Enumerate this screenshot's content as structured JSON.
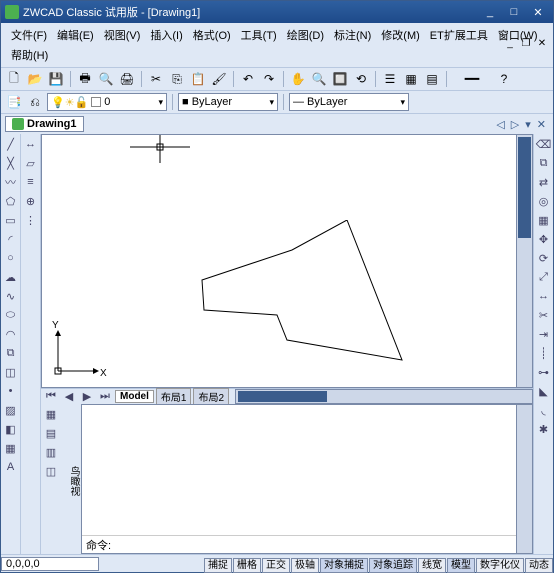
{
  "title": "ZWCAD Classic 试用版 - [Drawing1]",
  "menus": [
    "文件(F)",
    "编辑(E)",
    "视图(V)",
    "插入(I)",
    "格式(O)",
    "工具(T)",
    "绘图(D)",
    "标注(N)",
    "修改(M)",
    "ET扩展工具",
    "窗口(W)",
    "帮助(H)"
  ],
  "layer_combo": {
    "swatch": "#ffffff",
    "label": "0"
  },
  "bylayer1": "■ ByLayer",
  "bylayer2": "— ByLayer",
  "tab": {
    "name": "Drawing1"
  },
  "layout_tabs": [
    "Model",
    "布局1",
    "布局2"
  ],
  "cmd_prompt": "命令:",
  "coords": "0,0,0,0",
  "status_btns": [
    "捕捉",
    "栅格",
    "正交",
    "极轴",
    "对象捕捉",
    "对象追踪",
    "线宽",
    "模型",
    "数字化仪",
    "动态"
  ],
  "status_on": [
    4,
    5,
    7
  ],
  "axis": {
    "x": "X",
    "y": "Y"
  }
}
